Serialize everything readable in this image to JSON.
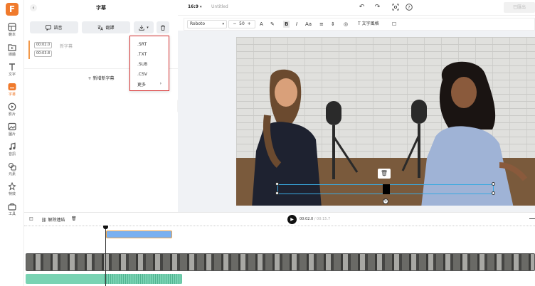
{
  "app": {
    "logo_letter": "F",
    "brand_color": "#f07a2c"
  },
  "rail": {
    "items": [
      {
        "label": "範本",
        "icon": "template-icon"
      },
      {
        "label": "媒體",
        "icon": "media-icon"
      },
      {
        "label": "文字",
        "icon": "text-icon"
      },
      {
        "label": "字幕",
        "icon": "subtitle-icon",
        "active": true
      },
      {
        "label": "影片",
        "icon": "video-icon"
      },
      {
        "label": "圖片",
        "icon": "image-icon"
      },
      {
        "label": "音訊",
        "icon": "music-icon"
      },
      {
        "label": "元素",
        "icon": "elements-icon"
      },
      {
        "label": "特效",
        "icon": "effects-icon"
      },
      {
        "label": "工具",
        "icon": "tools-icon"
      }
    ]
  },
  "panel": {
    "title": "字幕",
    "btn_voice": "語音",
    "btn_translate": "翻譯",
    "subtitle": {
      "start": "00:02.0",
      "end": "00:03.8",
      "text": "新字幕"
    },
    "add_label": "新增新字幕"
  },
  "download_menu": {
    "items": [
      ".SRT",
      ".TXT",
      ".SUB",
      ".CSV"
    ],
    "more": "更多"
  },
  "topbar": {
    "ratio": "16:9",
    "title": "Untitled",
    "export_label": "已匯出"
  },
  "text_toolbar": {
    "font": "Roboto",
    "size": "50",
    "effects_label": "文字風格"
  },
  "timeline": {
    "unlink_label": "解除連結",
    "current_time": "00:02.0",
    "total_time": "/ 00:15.7"
  }
}
